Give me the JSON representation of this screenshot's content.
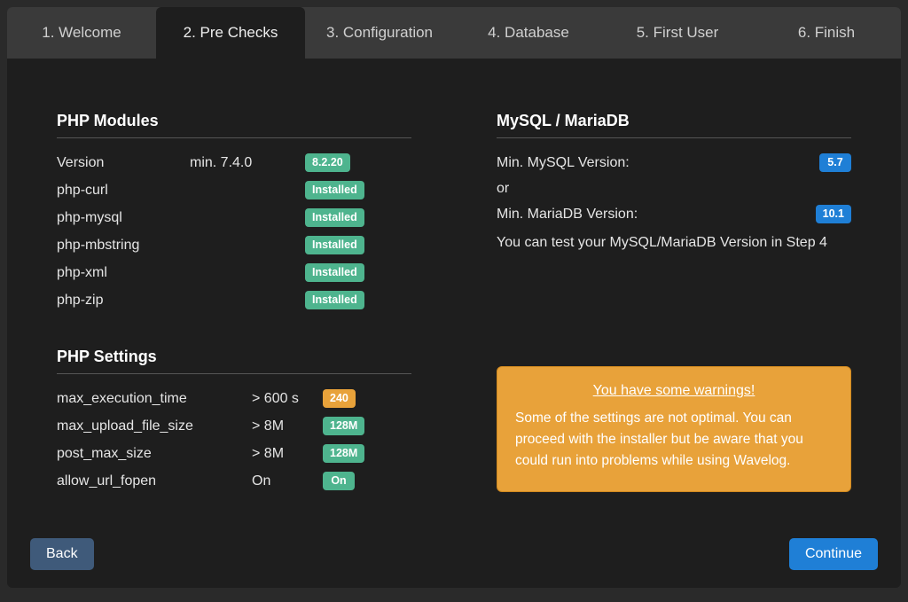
{
  "tabs": [
    {
      "label": "1. Welcome"
    },
    {
      "label": "2. Pre Checks"
    },
    {
      "label": "3. Configuration"
    },
    {
      "label": "4. Database"
    },
    {
      "label": "5. First User"
    },
    {
      "label": "6. Finish"
    }
  ],
  "activeTab": 1,
  "leftCol": {
    "phpModules": {
      "title": "PHP Modules",
      "rows": [
        {
          "name": "Version",
          "req": "min. 7.4.0",
          "badge": "8.2.20",
          "color": "green"
        },
        {
          "name": "php-curl",
          "req": "",
          "badge": "Installed",
          "color": "green"
        },
        {
          "name": "php-mysql",
          "req": "",
          "badge": "Installed",
          "color": "green"
        },
        {
          "name": "php-mbstring",
          "req": "",
          "badge": "Installed",
          "color": "green"
        },
        {
          "name": "php-xml",
          "req": "",
          "badge": "Installed",
          "color": "green"
        },
        {
          "name": "php-zip",
          "req": "",
          "badge": "Installed",
          "color": "green"
        }
      ]
    },
    "phpSettings": {
      "title": "PHP Settings",
      "rows": [
        {
          "name": "max_execution_time",
          "req": "> 600 s",
          "badge": "240",
          "color": "orange"
        },
        {
          "name": "max_upload_file_size",
          "req": "> 8M",
          "badge": "128M",
          "color": "green"
        },
        {
          "name": "post_max_size",
          "req": "> 8M",
          "badge": "128M",
          "color": "green"
        },
        {
          "name": "allow_url_fopen",
          "req": "On",
          "badge": "On",
          "color": "green"
        }
      ]
    }
  },
  "rightCol": {
    "db": {
      "title": "MySQL / MariaDB",
      "mysqlLabel": "Min. MySQL Version:",
      "mysqlBadge": "5.7",
      "orText": "or",
      "mariadbLabel": "Min. MariaDB Version:",
      "mariadbBadge": "10.1",
      "note": "You can test your MySQL/MariaDB Version in Step 4"
    },
    "alert": {
      "title": "You have some warnings!",
      "body": "Some of the settings are not optimal. You can proceed with the installer but be aware that you could run into problems while using Wavelog."
    }
  },
  "buttons": {
    "back": "Back",
    "continue": "Continue"
  },
  "colors": {
    "green": "#4eb48e",
    "orange": "#e8a23a",
    "blue": "#1f7fd6"
  }
}
